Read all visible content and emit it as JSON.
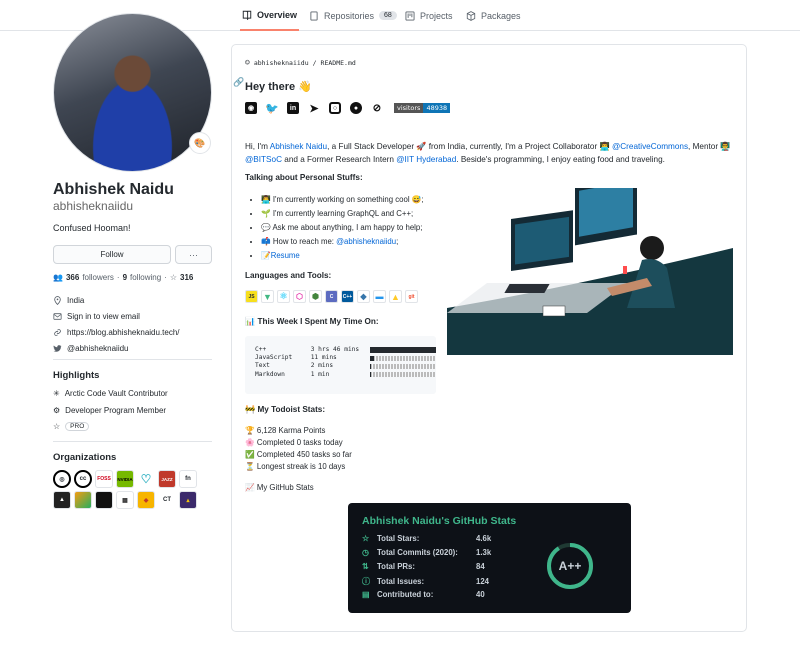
{
  "tabs": [
    {
      "label": "Overview",
      "icon": "book-icon"
    },
    {
      "label": "Repositories",
      "count": "68",
      "icon": "repo-icon"
    },
    {
      "label": "Projects",
      "icon": "project-icon"
    },
    {
      "label": "Packages",
      "icon": "package-icon"
    }
  ],
  "profile": {
    "name": "Abhishek Naidu",
    "login": "abhisheknaiidu",
    "bio": "Confused Hooman!",
    "follow_label": "Follow",
    "more_label": "···",
    "followers": "366",
    "followers_label": "followers",
    "following": "9",
    "following_label": "following",
    "stars": "316",
    "location": "India",
    "email": "Sign in to view email",
    "website": "https://blog.abhisheknaidu.tech/",
    "twitter": "@abhisheknaiidu"
  },
  "highlights": {
    "title": "Highlights",
    "items": [
      "Arctic Code Vault Contributor",
      "Developer Program Member",
      "PRO"
    ]
  },
  "organizations": {
    "title": "Organizations",
    "items": [
      "openmined-icon",
      "creativecommons-icon",
      "fossasia-icon",
      "nvidia-icon",
      "heart-icon",
      "jazzband-icon",
      "fn-icon",
      "ghost-icon",
      "gradient-icon",
      "black-square-icon",
      "robot-icon",
      "flame-icon",
      "ct-icon",
      "pixel-icon"
    ]
  },
  "readme": {
    "path_owner": "abhisheknaiidu",
    "path_file": "README.md",
    "greeting": "Hey there 👋",
    "visitors_label": "visitors",
    "visitors_count": "48938",
    "intro": {
      "p1": "Hi, I'm ",
      "name_link": "Abhishek Naidu",
      "p2": ", a Full Stack Developer 🚀 from India, currently, I'm a Project Collaborator 👨‍💻 ",
      "cc_link": "@CreativeCommons",
      "p3": ", Mentor 👨‍🏫 ",
      "bitsoc_link": "@BITSoC",
      "p4": " and a Former Research Intern ",
      "iit_link": "@IIT Hyderabad",
      "p5": ". Beside's programming, I enjoy eating food and traveling."
    },
    "personal_title": "Talking about Personal Stuffs:",
    "bullets": [
      "👨‍💻 I'm currently working on something cool 😅;",
      "🌱 I'm currently learning GraphQL and C++;",
      "💬 Ask me about anything, I am happy to help;",
      "📫 How to reach me: "
    ],
    "reach_link": "@abhisheknaiidu",
    "reach_suffix": ";",
    "resume_prefix": "📝",
    "resume_link": "Resume",
    "tools_title": "Languages and Tools:",
    "tools": [
      "JS",
      "Vue",
      "React",
      "GraphQL",
      "Node",
      "C",
      "C++",
      "Python",
      "Docker",
      "Firebase",
      "Git"
    ],
    "week_title": "📊 This Week I Spent My Time On:",
    "week": [
      {
        "lang": "C++",
        "time": "3 hrs 46 mins",
        "fill": 1.0
      },
      {
        "lang": "JavaScript",
        "time": "11 mins",
        "fill": 0.05
      },
      {
        "lang": "Text",
        "time": "2 mins",
        "fill": 0.01
      },
      {
        "lang": "Markdown",
        "time": "1 min",
        "fill": 0.005
      }
    ],
    "todoist_title": "🚧 My Todoist Stats:",
    "todoist": [
      "🏆 6,128 Karma Points",
      "🌸 Completed 0 tasks today",
      "✅ Completed 450 tasks so far",
      "⏳ Longest streak is 10 days"
    ],
    "github_stats_heading": "📈 My GitHub Stats"
  },
  "gh_stats": {
    "title": "Abhishek Naidu's GitHub Stats",
    "rows": [
      {
        "label": "Total Stars:",
        "value": "4.6k",
        "icon": "☆"
      },
      {
        "label": "Total Commits (2020):",
        "value": "1.3k",
        "icon": "◷"
      },
      {
        "label": "Total PRs:",
        "value": "84",
        "icon": "⇅"
      },
      {
        "label": "Total Issues:",
        "value": "124",
        "icon": "ⓘ"
      },
      {
        "label": "Contributed to:",
        "value": "40",
        "icon": "▤"
      }
    ],
    "grade": "A++",
    "accent": "#3fb68b",
    "background": "#0d1117"
  }
}
